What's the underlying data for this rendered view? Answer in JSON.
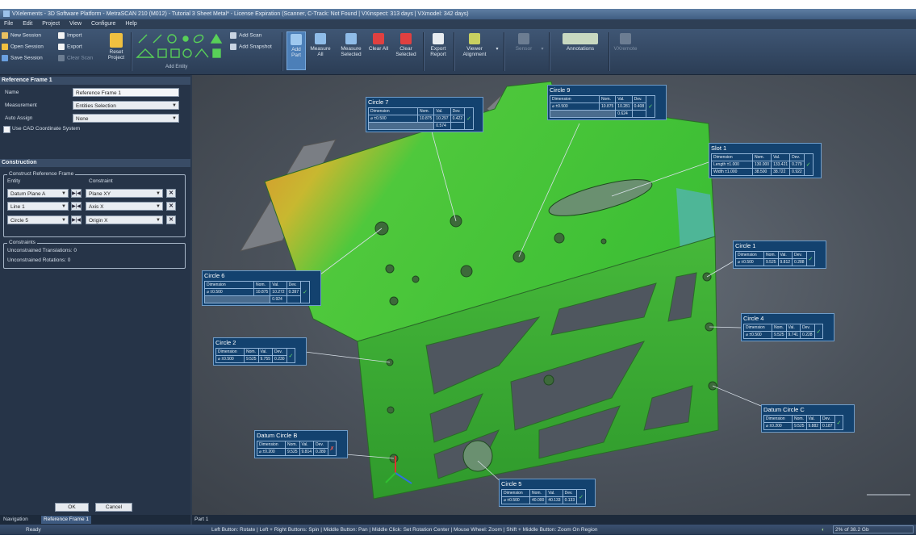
{
  "window": {
    "title": "VXelements - 3D Software Platform - MetraSCAN 210 (M012) - Tutorial 3 Sheet Metal* - License Expiration (Scanner, C-Track: Not Found | VXinspect: 313 days | VXmodel: 342 days)"
  },
  "menu": [
    "File",
    "Edit",
    "Project",
    "View",
    "Configure",
    "Help"
  ],
  "ribbon": {
    "session": {
      "new": "New Session",
      "open": "Open Session",
      "save": "Save Session",
      "import": "Import",
      "export": "Export",
      "clear_scan": "Clear Scan"
    },
    "reset_project": "Reset Project",
    "add_entity": "Add Entity",
    "add_scan": "Add Scan",
    "add_snapshot": "Add Snapshot",
    "add_part": "Add Part",
    "measure_all": "Measure All",
    "measure_selected": "Measure Selected",
    "clear_all": "Clear All",
    "clear_selected": "Clear Selected",
    "export_report": "Export Report",
    "viewer_alignment": "Viewer Alignment",
    "sensor": "Sensor",
    "annotations": "Annotations",
    "vxremote": "VXremote"
  },
  "panel": {
    "title": "Reference Frame 1",
    "name_label": "Name",
    "name_value": "Reference Frame 1",
    "measurement_label": "Measurement",
    "measurement_value": "Entities Selection",
    "auto_assign_label": "Auto Assign",
    "auto_assign_value": "None",
    "use_cad_label": "Use CAD Coordinate System",
    "construction_title": "Construction",
    "construct_group": "Construct Reference Frame",
    "entity_header": "Entity",
    "constraint_header": "Constraint",
    "rows": [
      {
        "entity": "Datum Plane A",
        "constraint": "Plane XY"
      },
      {
        "entity": "Line 1",
        "constraint": "Axis X"
      },
      {
        "entity": "Circle 5",
        "constraint": "Origin X"
      }
    ],
    "constraints_group": "Constraints",
    "unconstrained_translations": "Unconstrained Translations:  0",
    "unconstrained_rotations": "Unconstrained Rotations:  0",
    "ok": "OK",
    "cancel": "Cancel"
  },
  "nav_tabs": [
    "Navigation",
    "Reference Frame 1"
  ],
  "viewport_tab": "Part 1",
  "status": {
    "ready": "Ready",
    "hint": "Left Button: Rotate | Left + Right Buttons: Spin | Middle Button: Pan | Middle Click: Set Rotation Center | Mouse Wheel: Zoom | Shift + Middle Button: Zoom On Region",
    "memory": "2% of 38.2 Gb"
  },
  "callouts": [
    {
      "title": "Circle 7",
      "header": [
        "Dimension",
        "Nom.",
        "Val.",
        "Dev."
      ],
      "row": [
        "⌀  ±0.500",
        "10.875",
        "10.297",
        "0.422"
      ],
      "extra": "0.574",
      "state": "ok"
    },
    {
      "title": "Circle 9",
      "header": [
        "Dimension",
        "Nom.",
        "Val.",
        "Dev."
      ],
      "row": [
        "⌀  ±0.500",
        "10.875",
        "10.281",
        "0.408"
      ],
      "extra": "0.624",
      "state": "ok"
    },
    {
      "title": "Slot 1",
      "header": [
        "Dimension",
        "Nom.",
        "Val.",
        "Dev."
      ],
      "row": [
        "Length  ±1.000",
        "130.000",
        "133.421",
        "0.279"
      ],
      "row2": [
        "Width  ±1.000",
        "38.500",
        "38.722",
        "0.922"
      ],
      "state": "ok"
    },
    {
      "title": "Circle 1",
      "header": [
        "Dimension",
        "Nom.",
        "Val.",
        "Dev."
      ],
      "row": [
        "⌀  ±0.500",
        "9.525",
        "9.812",
        "0.288"
      ],
      "state": "ok"
    },
    {
      "title": "Circle 6",
      "header": [
        "Dimension",
        "Nom.",
        "Val.",
        "Dev."
      ],
      "row": [
        "⌀  ±0.500",
        "10.875",
        "10.272",
        "0.397"
      ],
      "extra": "0.924",
      "state": "ok"
    },
    {
      "title": "Circle 4",
      "header": [
        "Dimension",
        "Nom.",
        "Val.",
        "Dev."
      ],
      "row": [
        "⌀  ±0.500",
        "9.525",
        "9.741",
        "0.228"
      ],
      "state": "ok"
    },
    {
      "title": "Circle 2",
      "header": [
        "Dimension",
        "Nom.",
        "Val.",
        "Dev."
      ],
      "row": [
        "⌀  ±0.500",
        "9.525",
        "9.755",
        "0.230"
      ],
      "state": "ok"
    },
    {
      "title": "Datum Circle C",
      "header": [
        "Dimension",
        "Nom.",
        "Val.",
        "Dev."
      ],
      "row": [
        "⌀  ±0.200",
        "9.525",
        "9.882",
        "0.187"
      ],
      "state": "ok"
    },
    {
      "title": "Datum Circle B",
      "header": [
        "Dimension",
        "Nom.",
        "Val.",
        "Dev."
      ],
      "row": [
        "⌀  ±0.200",
        "9.525",
        "9.814",
        "0.289"
      ],
      "state": "bad"
    },
    {
      "title": "Circle 5",
      "header": [
        "Dimension",
        "Nom.",
        "Val.",
        "Dev."
      ],
      "row": [
        "⌀  ±0.500",
        "40.000",
        "40.133",
        "0.133"
      ],
      "state": "ok"
    }
  ]
}
